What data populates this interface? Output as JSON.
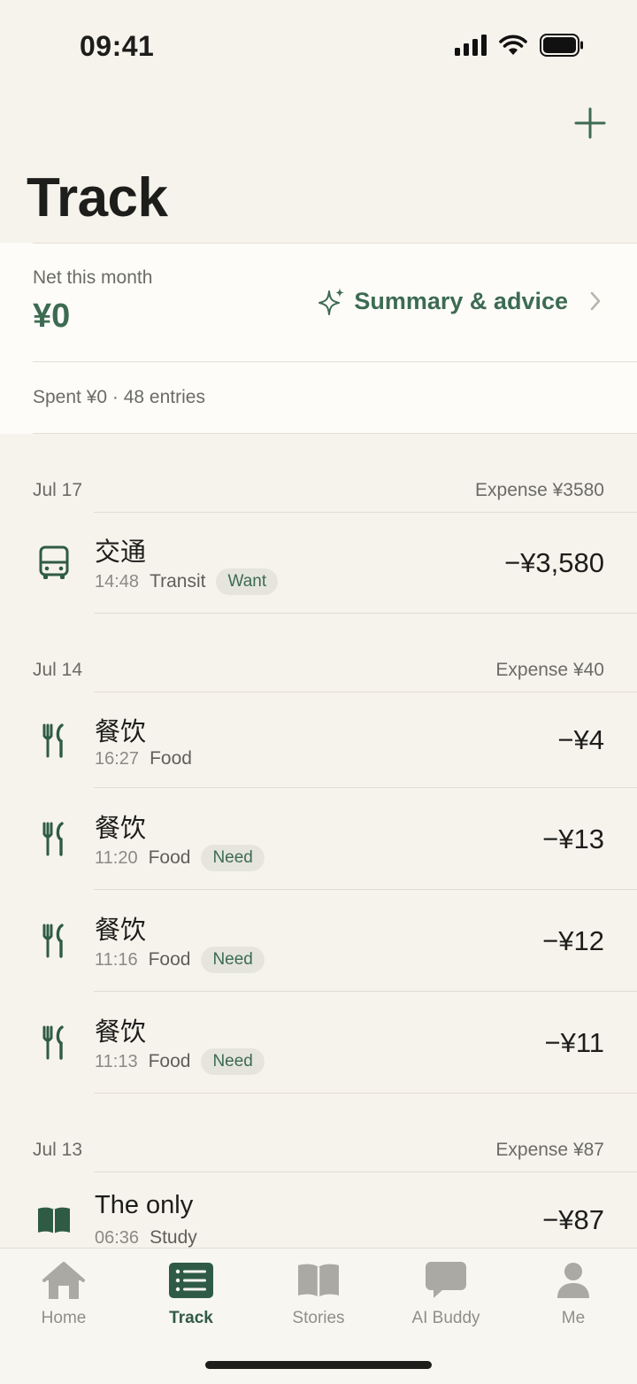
{
  "status_bar": {
    "time": "09:41"
  },
  "header": {
    "title": "Track"
  },
  "summary": {
    "net_label": "Net this month",
    "net_value": "¥0",
    "advice_label": "Summary & advice",
    "spent_text": "Spent ¥0 · 48 entries"
  },
  "days": [
    {
      "date": "Jul 17",
      "total": "Expense ¥3580",
      "entries": [
        {
          "title": "交通",
          "time": "14:48",
          "category": "Transit",
          "tag": "Want",
          "amount": "−¥3,580",
          "icon": "bus-icon"
        }
      ]
    },
    {
      "date": "Jul 14",
      "total": "Expense ¥40",
      "entries": [
        {
          "title": "餐饮",
          "time": "16:27",
          "category": "Food",
          "tag": "",
          "amount": "−¥4",
          "icon": "fork-knife-icon"
        },
        {
          "title": "餐饮",
          "time": "11:20",
          "category": "Food",
          "tag": "Need",
          "amount": "−¥13",
          "icon": "fork-knife-icon"
        },
        {
          "title": "餐饮",
          "time": "11:16",
          "category": "Food",
          "tag": "Need",
          "amount": "−¥12",
          "icon": "fork-knife-icon"
        },
        {
          "title": "餐饮",
          "time": "11:13",
          "category": "Food",
          "tag": "Need",
          "amount": "−¥11",
          "icon": "fork-knife-icon"
        }
      ]
    },
    {
      "date": "Jul 13",
      "total": "Expense ¥87",
      "entries": [
        {
          "title": "The only",
          "time": "06:36",
          "category": "Study",
          "tag": "",
          "amount": "−¥87",
          "icon": "book-icon"
        }
      ]
    }
  ],
  "tabbar": [
    {
      "label": "Home",
      "icon": "home-icon",
      "active": false
    },
    {
      "label": "Track",
      "icon": "list-icon",
      "active": true
    },
    {
      "label": "Stories",
      "icon": "book-icon",
      "active": false
    },
    {
      "label": "AI Buddy",
      "icon": "chat-bubble-icon",
      "active": false
    },
    {
      "label": "Me",
      "icon": "person-icon",
      "active": false
    }
  ],
  "colors": {
    "accent": "#3d6b52",
    "background": "#f6f3ec",
    "card": "#fdfcf9"
  }
}
